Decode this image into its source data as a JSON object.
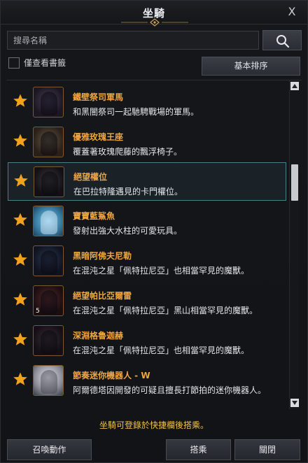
{
  "window": {
    "title": "坐騎",
    "close_label": "X"
  },
  "search": {
    "placeholder": "搜尋名稱",
    "value": ""
  },
  "filters": {
    "bookmark_only_label": "僅查看書籤",
    "bookmark_only_checked": false
  },
  "sort": {
    "label": "基本排序"
  },
  "mounts": [
    {
      "name": "鐵壁祭司軍馬",
      "desc": "和黑闇祭司一起馳騁戰場的軍馬。",
      "favorite": true,
      "badge": ""
    },
    {
      "name": "優雅玫瑰王座",
      "desc": "覆蓋著玫瑰爬藤的飄浮椅子。",
      "favorite": true,
      "badge": ""
    },
    {
      "name": "絕望權位",
      "desc": "在巴拉特隆遇見的卡門權位。",
      "favorite": true,
      "badge": "",
      "selected": true
    },
    {
      "name": "寶寶藍鯊魚",
      "desc": "發射出強大水柱的可愛玩具。",
      "favorite": true,
      "badge": ""
    },
    {
      "name": "黑暗阿佛夫尼勒",
      "desc": "在混沌之星「佩特拉尼亞」也相當罕見的魔獸。",
      "favorite": true,
      "badge": ""
    },
    {
      "name": "絕望帕比亞爾雷",
      "desc": "在混沌之星「佩特拉尼亞」黑山相當罕見的魔獸。",
      "favorite": true,
      "badge": "5"
    },
    {
      "name": "深淵格魯迦赫",
      "desc": "在混沌之星「佩特拉尼亞」也相當罕見的魔獸。",
      "favorite": true,
      "badge": ""
    },
    {
      "name": "節奏迷你機器人 - W",
      "desc": "阿爾德塔因開發的可疑且擅長打節拍的迷你機器人。",
      "favorite": true,
      "badge": ""
    }
  ],
  "info": {
    "text": "坐騎可登錄於快捷欄後搭乘。"
  },
  "buttons": {
    "summon_action": "召喚動作",
    "ride": "搭乘",
    "close": "關閉"
  },
  "colors": {
    "name": "#f0a640",
    "info": "#f0c24a",
    "star": "#f2a21c",
    "selected_border": "#4b7f8c"
  }
}
